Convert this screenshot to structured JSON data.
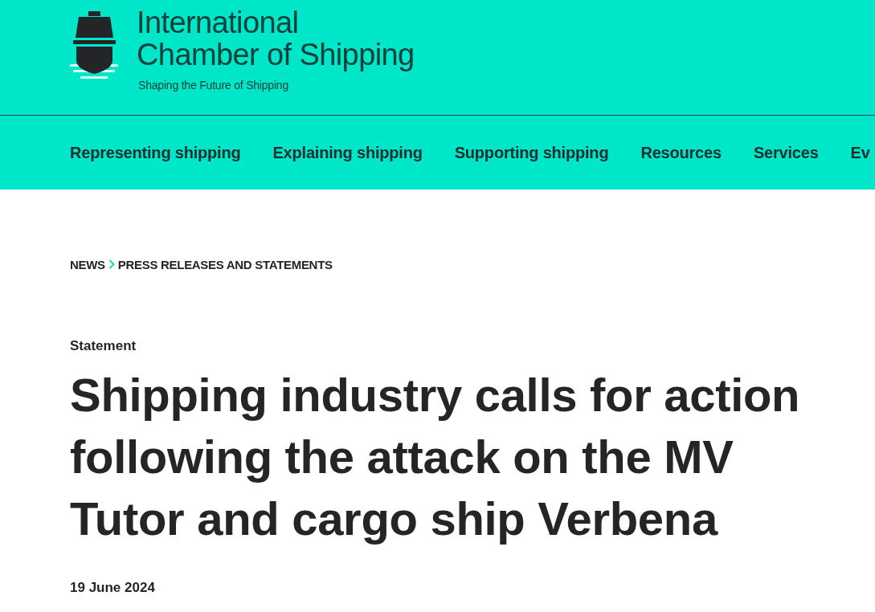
{
  "header": {
    "logo": {
      "title_lines": [
        "International",
        "Chamber of Shipping"
      ],
      "tagline": "Shaping the Future of Shipping"
    }
  },
  "nav": {
    "items": [
      "Representing shipping",
      "Explaining shipping",
      "Supporting shipping",
      "Resources",
      "Services",
      "Ev"
    ]
  },
  "breadcrumb": [
    "NEWS",
    "PRESS RELEASES AND STATEMENTS"
  ],
  "article": {
    "category": "Statement",
    "title": "Shipping industry calls for action following the attack on the MV Tutor and cargo ship Verbena",
    "date": "19 June 2024"
  }
}
